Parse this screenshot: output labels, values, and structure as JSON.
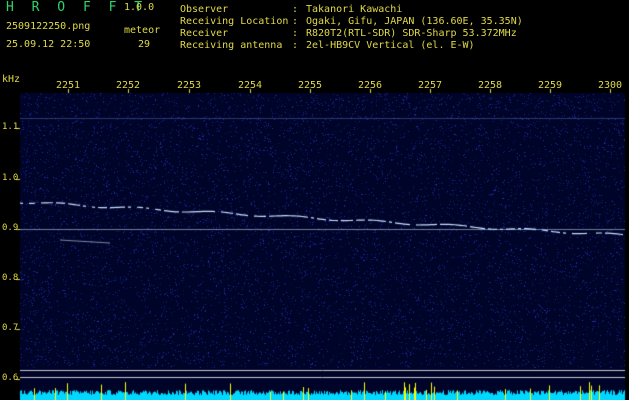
{
  "header": {
    "app_name": "H R O F F T",
    "version": "1.0.0",
    "filename": "2509122250.png",
    "datetime": "25.09.12 22:50",
    "meteor_label": "meteor",
    "meteor_count": "29"
  },
  "info": [
    {
      "key": "Observer",
      "value": "Takanori Kawachi"
    },
    {
      "key": "Receiving Location",
      "value": "Ogaki, Gifu, JAPAN (136.60E, 35.35N)"
    },
    {
      "key": "Receiver",
      "value": "R820T2(RTL-SDR) SDR-Sharp 53.372MHz"
    },
    {
      "key": "Receiving antenna",
      "value": "2el-HB9CV Vertical (el. E-W)"
    }
  ],
  "info_separator": ":",
  "spectrogram": {
    "y_unit": "kHz",
    "y_ticks": [
      "1.1",
      "1.0",
      "0.9",
      "0.8",
      "0.7",
      "0.6"
    ],
    "x_ticks": [
      "2251",
      "2252",
      "2253",
      "2254",
      "2255",
      "2256",
      "2257",
      "2258",
      "2259",
      "2300"
    ],
    "colors": {
      "background": "#000428",
      "noise": "#2a3cd8",
      "trace": "#c8e0ff",
      "bottom_band": "#00d8ff",
      "bottom_peak": "#ffff00",
      "text": "#e0d94a",
      "title": "#2fd36b"
    }
  }
}
